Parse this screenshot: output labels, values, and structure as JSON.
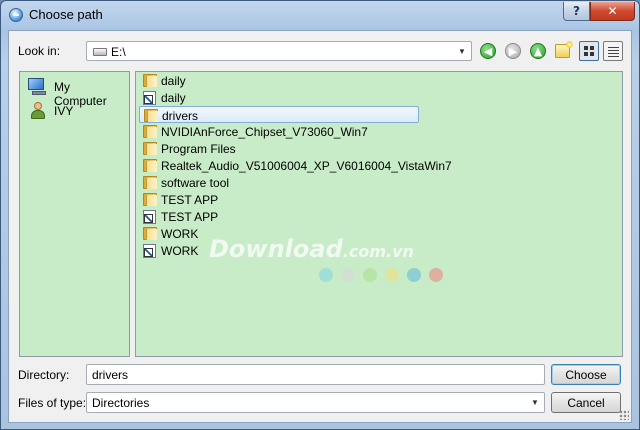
{
  "window": {
    "title": "Choose path",
    "help_label": "?",
    "close_label": "✕"
  },
  "toolbar": {
    "look_in_label": "Look in:",
    "look_in_value": "E:\\",
    "icons": [
      "back-icon",
      "forward-icon",
      "up-icon",
      "new-folder-icon",
      "list-view-icon",
      "detail-view-icon"
    ]
  },
  "sidebar": {
    "items": [
      {
        "label": "My Computer",
        "icon": "computer-icon"
      },
      {
        "label": "IVY",
        "icon": "user-icon"
      }
    ]
  },
  "files": {
    "items": [
      {
        "name": "daily",
        "type": "folder"
      },
      {
        "name": "daily",
        "type": "shortcut"
      },
      {
        "name": "drivers",
        "type": "folder",
        "selected": true
      },
      {
        "name": "NVIDIAnForce_Chipset_V73060_Win7",
        "type": "folder"
      },
      {
        "name": "Program Files",
        "type": "folder"
      },
      {
        "name": "Realtek_Audio_V51006004_XP_V6016004_VistaWin7",
        "type": "folder"
      },
      {
        "name": "software tool",
        "type": "folder"
      },
      {
        "name": "TEST APP",
        "type": "folder"
      },
      {
        "name": "TEST APP",
        "type": "shortcut"
      },
      {
        "name": "WORK",
        "type": "folder"
      },
      {
        "name": "WORK",
        "type": "shortcut"
      }
    ]
  },
  "watermark": {
    "main": "Download",
    "suffix": ".com.vn",
    "dot_colors": [
      "#7fd6e6",
      "#d8d8d8",
      "#a8e08a",
      "#f2e07a",
      "#5fb8d8",
      "#f08080"
    ]
  },
  "footer": {
    "directory_label": "Directory:",
    "directory_value": "drivers",
    "choose_label": "Choose",
    "files_of_type_label": "Files of type:",
    "files_of_type_value": "Directories",
    "cancel_label": "Cancel"
  },
  "colors": {
    "panel_background": "#c8ebc8",
    "selection_border": "#84acdd",
    "close_button": "#cf4a30"
  }
}
